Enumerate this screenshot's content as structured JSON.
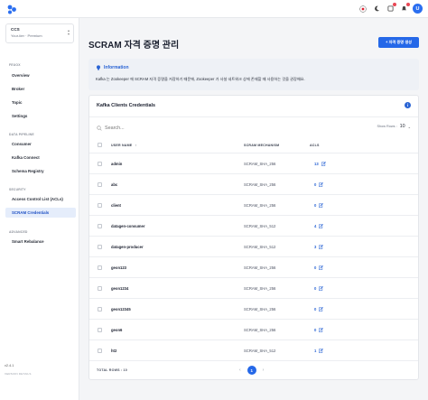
{
  "app": {
    "cluster_name": "CCS",
    "cluster_tier": "Your-tier · Premium",
    "version": "v2.4.1",
    "version_details": "VERSION DETAILS"
  },
  "topbar": {
    "icons": [
      "brand-logo",
      "language-icon",
      "moon-icon",
      "notifications-icon",
      "alerts-icon"
    ],
    "avatar_initial": "U"
  },
  "sidebar": {
    "sections": [
      {
        "title": "FEUOX",
        "items": [
          "Overview",
          "Broker",
          "Topic",
          "Settings"
        ]
      },
      {
        "title": "DATA PIPELINE",
        "items": [
          "Consumer",
          "Kafka Connect",
          "Schema Registry"
        ]
      },
      {
        "title": "SECURITY",
        "items": [
          "Access Control List (ACLs)",
          "SCRAM Credentials"
        ]
      },
      {
        "title": "ADVANCED",
        "items": [
          "Smart Rebalance"
        ]
      }
    ],
    "active_item": "SCRAM Credentials"
  },
  "page": {
    "title": "SCRAM 자격 증명 관리",
    "create_button": "+ 자격 증명 생성"
  },
  "info": {
    "heading": "Information",
    "text": "Kafka 는 Zookeeper 에 SCRAM 자격 증명을 저장하기 때문에, Zookeeper 가 사설 네트워크 상에 존재할 때 사용하는 것을 권장해요."
  },
  "table": {
    "title": "Kafka Clients Credentials",
    "search_placeholder": "Search...",
    "show_rows_label": "Show Rows :",
    "show_rows_value": "10",
    "columns": [
      "USER NAME",
      "SCRAM MECHANISM",
      "ACLS"
    ],
    "sort_indicator": "↑",
    "rows": [
      {
        "user": "admin",
        "mechanism": "SCRAM_SHA_256",
        "acls": "13"
      },
      {
        "user": "abc",
        "mechanism": "SCRAM_SHA_256",
        "acls": "0"
      },
      {
        "user": "client",
        "mechanism": "SCRAM_SHA_256",
        "acls": "0"
      },
      {
        "user": "datagen-consumer",
        "mechanism": "SCRAM_SHA_512",
        "acls": "4"
      },
      {
        "user": "datagen-producer",
        "mechanism": "SCRAM_SHA_512",
        "acls": "3"
      },
      {
        "user": "geon123",
        "mechanism": "SCRAM_SHA_256",
        "acls": "0"
      },
      {
        "user": "geon1234",
        "mechanism": "SCRAM_SHA_256",
        "acls": "0"
      },
      {
        "user": "geon12345",
        "mechanism": "SCRAM_SHA_256",
        "acls": "0"
      },
      {
        "user": "geon6",
        "mechanism": "SCRAM_SHA_256",
        "acls": "0"
      },
      {
        "user": "ht2",
        "mechanism": "SCRAM_SHA_512",
        "acls": "1"
      }
    ],
    "total_rows_label": "TOTAL ROWS : 10",
    "pagination": {
      "prev": "‹",
      "current": "1",
      "next": "›"
    }
  },
  "colors": {
    "accent": "#2568e8",
    "active_nav_bg": "#e5edfb",
    "info_bg": "#eef1f6"
  }
}
